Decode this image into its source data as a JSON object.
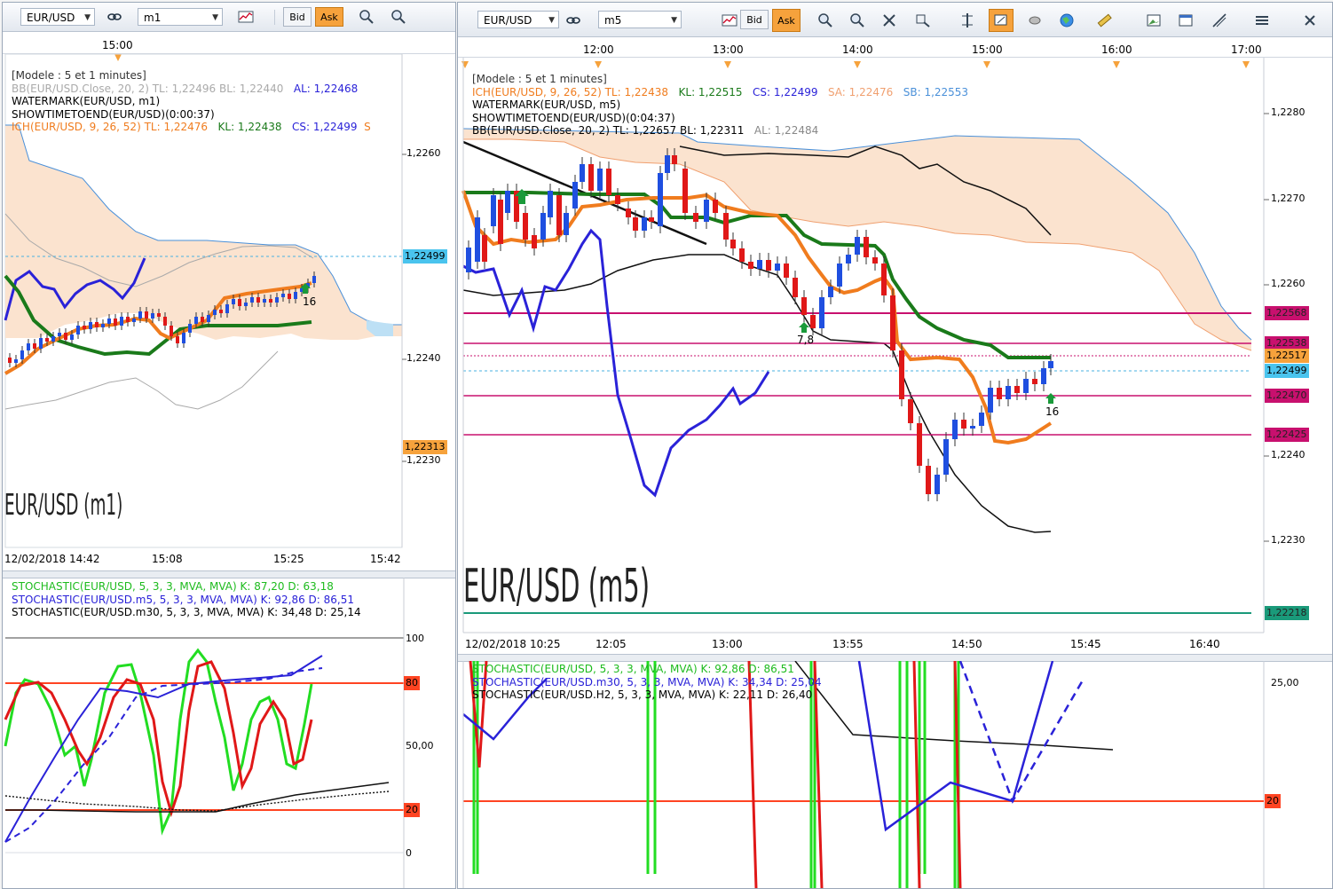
{
  "left": {
    "symbol": "EUR/USD",
    "timeframe": "m1",
    "bid_label": "Bid",
    "ask_label": "Ask",
    "top_time": "15:00",
    "legend": [
      "[Modele : 5 et 1 minutes]",
      "BB(EUR/USD.Close, 20, 2)  TL: 1,22496  BL: 1,22440",
      "AL: 1,22468",
      "WATERMARK(EUR/USD, m1)",
      "SHOWTIMETOEND(EUR/USD)(0:00:37)",
      "ICH(EUR/USD, 9, 26, 52)  TL: 1,22476",
      "KL: 1,22438",
      "CS: 1,22499",
      "S"
    ],
    "price_ticks": [
      "1,2260",
      "1,2240",
      "1,2230"
    ],
    "price_current": "1,22499",
    "price_low_box": "1,22313",
    "watermark": "EUR/USD (m1)",
    "signal_label": "16",
    "bottom_times": [
      "12/02/2018 14:42",
      "15:08",
      "15:25",
      "15:42"
    ],
    "stoch_legend": [
      "STOCHASTIC(EUR/USD, 5, 3, 3, MVA, MVA)  K: 87,20  D: 63,18",
      "STOCHASTIC(EUR/USD.m5, 5, 3, 3, MVA, MVA)  K: 92,86  D: 86,51",
      "STOCHASTIC(EUR/USD.m30, 5, 3, 3, MVA, MVA)  K: 34,48  D: 25,14"
    ],
    "stoch_ticks": [
      "100",
      "80",
      "50,00",
      "20",
      "0"
    ]
  },
  "right": {
    "symbol": "EUR/USD",
    "timeframe": "m5",
    "bid_label": "Bid",
    "ask_label": "Ask",
    "top_times": [
      "12:00",
      "13:00",
      "14:00",
      "15:00",
      "16:00",
      "17:00"
    ],
    "legend": [
      "[Modele : 5 et 1 minutes]",
      "ICH(EUR/USD, 9, 26, 52)  TL: 1,22438",
      "KL: 1,22515",
      "CS: 1,22499",
      "SA: 1,22476",
      "SB: 1,22553",
      "WATERMARK(EUR/USD, m5)",
      "SHOWTIMETOEND(EUR/USD)(0:04:37)",
      "BB(EUR/USD.Close, 20, 2)  TL: 1,22657  BL: 1,22311",
      "AL: 1,22484"
    ],
    "price_ticks": [
      "1,2280",
      "1,2270",
      "1,2260",
      "1,2240",
      "1,2230"
    ],
    "price_boxes": [
      "1,22568",
      "1,22538",
      "1,22517",
      "1,22499",
      "1,22470",
      "1,22425",
      "1,22218"
    ],
    "watermark": "EUR/USD (m5)",
    "signal_labels": [
      "7,8",
      "16"
    ],
    "bottom_times": [
      "12/02/2018 10:25",
      "12:05",
      "13:00",
      "13:55",
      "14:50",
      "15:45",
      "16:40"
    ],
    "stoch_legend": [
      "STOCHASTIC(EUR/USD, 5, 3, 3, MVA, MVA)  K: 92,86  D: 86,51",
      "STOCHASTIC(EUR/USD.m30, 5, 3, 3, MVA, MVA)  K: 34,34  D: 25,04",
      "STOCHASTIC(EUR/USD.H2, 5, 3, 3, MVA, MVA)  K: 22,11  D: 26,40"
    ],
    "stoch_ticks": [
      "25,00",
      "20"
    ]
  },
  "colors": {
    "up": "#1f4fe0",
    "down": "#e01818",
    "tenkan": "#f07c1e",
    "kijun": "#1a7a1a",
    "chikou": "#2a22d8",
    "cloud": "#fbe3cf",
    "stoch_k": "#22dd22",
    "stoch_d": "#e01818",
    "magenta": "#c8106e",
    "ask": "#f6a23c"
  }
}
